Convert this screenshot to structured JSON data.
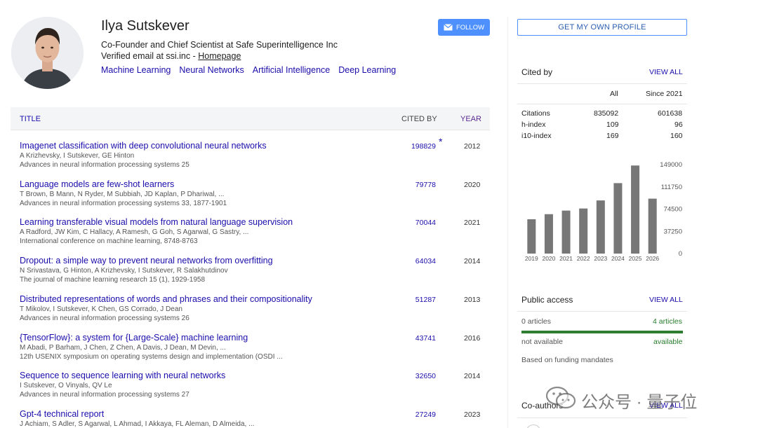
{
  "profile": {
    "name": "Ilya Sutskever",
    "affiliation": "Co-Founder and Chief Scientist at Safe Superintelligence Inc",
    "email_text": "Verified email at ssi.inc - ",
    "homepage_label": "Homepage",
    "interests": [
      "Machine Learning",
      "Neural Networks",
      "Artificial Intelligence",
      "Deep Learning"
    ]
  },
  "buttons": {
    "follow_label": "FOLLOW",
    "get_profile_label": "GET MY OWN PROFILE"
  },
  "table": {
    "headers": {
      "title": "TITLE",
      "cited_by": "CITED BY",
      "year": "YEAR"
    },
    "rows": [
      {
        "title": "Imagenet classification with deep convolutional neural networks",
        "authors": "A Krizhevsky, I Sutskever, GE Hinton",
        "venue": "Advances in neural information processing systems 25",
        "cited": "198829",
        "year": "2012",
        "star": "*"
      },
      {
        "title": "Language models are few-shot learners",
        "authors": "T Brown, B Mann, N Ryder, M Subbiah, JD Kaplan, P Dhariwal, ...",
        "venue": "Advances in neural information processing systems 33, 1877-1901",
        "cited": "79778",
        "year": "2020"
      },
      {
        "title": "Learning transferable visual models from natural language supervision",
        "authors": "A Radford, JW Kim, C Hallacy, A Ramesh, G Goh, S Agarwal, G Sastry, ...",
        "venue": "International conference on machine learning, 8748-8763",
        "cited": "70044",
        "year": "2021"
      },
      {
        "title": "Dropout: a simple way to prevent neural networks from overfitting",
        "authors": "N Srivastava, G Hinton, A Krizhevsky, I Sutskever, R Salakhutdinov",
        "venue": "The journal of machine learning research 15 (1), 1929-1958",
        "cited": "64034",
        "year": "2014"
      },
      {
        "title": "Distributed representations of words and phrases and their compositionality",
        "authors": "T Mikolov, I Sutskever, K Chen, GS Corrado, J Dean",
        "venue": "Advances in neural information processing systems 26",
        "cited": "51287",
        "year": "2013"
      },
      {
        "title": "{TensorFlow}: a system for {Large-Scale} machine learning",
        "authors": "M Abadi, P Barham, J Chen, Z Chen, A Davis, J Dean, M Devin, ...",
        "venue": "12th USENIX symposium on operating systems design and implementation (OSDI ...",
        "cited": "43741",
        "year": "2016"
      },
      {
        "title": "Sequence to sequence learning with neural networks",
        "authors": "I Sutskever, O Vinyals, QV Le",
        "venue": "Advances in neural information processing systems 27",
        "cited": "32650",
        "year": "2014"
      },
      {
        "title": "Gpt-4 technical report",
        "authors": "J Achiam, S Adler, S Agarwal, L Ahmad, I Akkaya, FL Aleman, D Almeida, ...",
        "venue": "",
        "cited": "27249",
        "year": "2023"
      }
    ]
  },
  "cited_by": {
    "title": "Cited by",
    "view_all": "VIEW ALL",
    "col_all": "All",
    "col_since": "Since 2021",
    "metrics": [
      {
        "label": "Citations",
        "all": "835092",
        "since": "601638"
      },
      {
        "label": "h-index",
        "all": "109",
        "since": "96"
      },
      {
        "label": "i10-index",
        "all": "169",
        "since": "160"
      }
    ]
  },
  "chart_data": {
    "type": "bar",
    "title": "",
    "categories": [
      "2019",
      "2020",
      "2021",
      "2022",
      "2023",
      "2024",
      "2025",
      "2026"
    ],
    "values": [
      57500,
      66000,
      72000,
      75500,
      89000,
      118000,
      147500,
      92000
    ],
    "ylim": [
      0,
      149000
    ],
    "yticks": [
      "149000",
      "111750",
      "74500",
      "37250",
      "0"
    ],
    "bar_color": "#777777"
  },
  "public_access": {
    "title": "Public access",
    "view_all": "VIEW ALL",
    "left_count": "0 articles",
    "right_count": "4 articles",
    "left_status": "not available",
    "right_status": "available",
    "note": "Based on funding mandates"
  },
  "coauthors": {
    "title": "Co-authors",
    "view_all": "VIEW ALL"
  },
  "watermark": {
    "text": "公众号 · 量子位"
  }
}
